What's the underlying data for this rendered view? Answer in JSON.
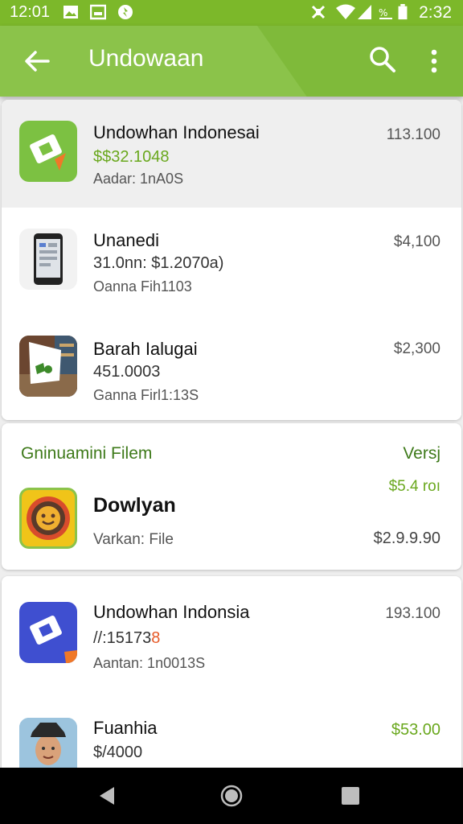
{
  "status_bar": {
    "time_left": "12:01",
    "time_right": "2:32",
    "icons": [
      "image-icon",
      "gallery-icon",
      "app-notification-icon",
      "vibrate-icon",
      "wifi-icon",
      "signal-icon",
      "data-off-icon",
      "battery-icon"
    ]
  },
  "app_bar": {
    "title": "Undowaan",
    "icons": [
      "back-arrow-icon",
      "search-icon",
      "more-vert-icon"
    ],
    "color": "#8bc34a"
  },
  "list": [
    {
      "name": "Undowhan Indonesai",
      "subtitle": "$$32.1048",
      "meta": "Aadar: 1nA0S",
      "price": "113.100",
      "icon": "app-logo-green-icon"
    },
    {
      "name": "Unanedi",
      "subtitle": "31.0nn: $1.2070a)",
      "meta": "Oanna Fih1103",
      "price": "$4,100",
      "icon": "phone-app-icon"
    },
    {
      "name": "Barah Ialugai",
      "subtitle": "451.0003",
      "meta": "Ganna Firl1:13S",
      "price": "$2,300",
      "icon": "photo-app-icon"
    }
  ],
  "section": {
    "header_left": "Gninuamini Filem",
    "header_right": "Versj",
    "price_top": "$5.4 roı",
    "name": "Dowlyan",
    "meta": "Varkan: File",
    "price": "$2.9.9.90",
    "icon": "game-app-icon"
  },
  "list2": [
    {
      "name": "Undowhan Indonsia",
      "subtitle_prefix": "//:15173",
      "subtitle_suffix": "8",
      "meta": "Aantan: 1n0013S",
      "price": "193.100",
      "icon": "app-logo-blue-icon"
    },
    {
      "name": "Fuanhia",
      "subtitle": "$/4000",
      "price": "$53.00",
      "icon": "avatar-photo-icon"
    }
  ],
  "nav_bar": {
    "icons": [
      "nav-back-icon",
      "nav-home-icon",
      "nav-recents-icon"
    ]
  },
  "colors": {
    "accent": "#8bc34a",
    "price_green": "#6aa81e",
    "highlight_orange": "#e65a28"
  }
}
